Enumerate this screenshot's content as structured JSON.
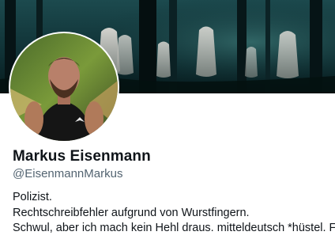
{
  "profile": {
    "display_name": "Markus Eisenmann",
    "handle": "@EisenmannMarkus",
    "bio": [
      "Polizist.",
      "Rechtschreibfehler aufgrund von Wurstfingern.",
      "Schwul, aber ich mach kein Hehl draus. mitteldeutsch *hüstel. F"
    ]
  },
  "colors": {
    "name": "#0f1419",
    "handle": "#536471",
    "banner_dark": "#0e2a2e"
  },
  "icons": {
    "banner": "forest-ghosts-banner-image",
    "avatar": "profile-photo"
  }
}
